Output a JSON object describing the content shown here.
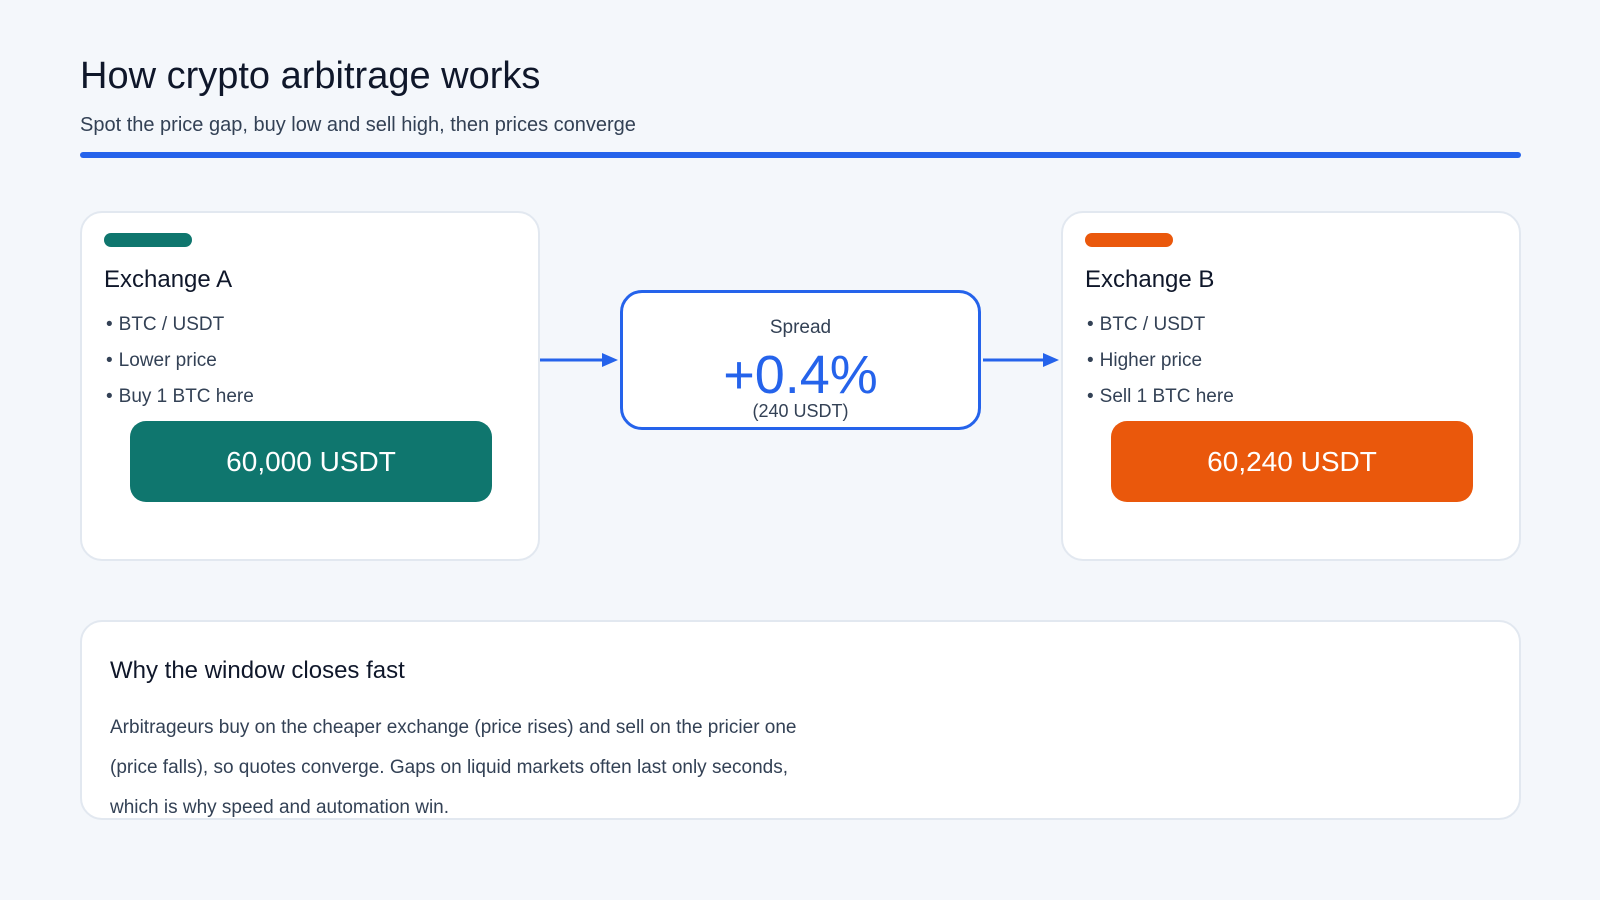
{
  "header": {
    "title": "How crypto arbitrage works",
    "subtitle": "Spot the price gap, buy low and sell high, then prices converge"
  },
  "colors": {
    "accent": "#2563eb",
    "exchange_a": "#0f766e",
    "exchange_b": "#ea580c"
  },
  "exchange_a": {
    "title": "Exchange A",
    "bullets": [
      "BTC / USDT",
      "Lower price",
      "Buy 1 BTC here"
    ],
    "price": "60,000 USDT"
  },
  "exchange_b": {
    "title": "Exchange B",
    "bullets": [
      "BTC / USDT",
      "Higher price",
      "Sell 1 BTC here"
    ],
    "price": "60,240 USDT"
  },
  "spread": {
    "label": "Spread",
    "value": "+0.4%",
    "detail": "(240 USDT)"
  },
  "info": {
    "title": "Why the window closes fast",
    "lines": [
      "Arbitrageurs buy on the cheaper exchange (price rises) and sell on the pricier one",
      "(price falls), so quotes converge. Gaps on liquid markets often last only seconds,",
      "which is why speed and automation win."
    ]
  }
}
